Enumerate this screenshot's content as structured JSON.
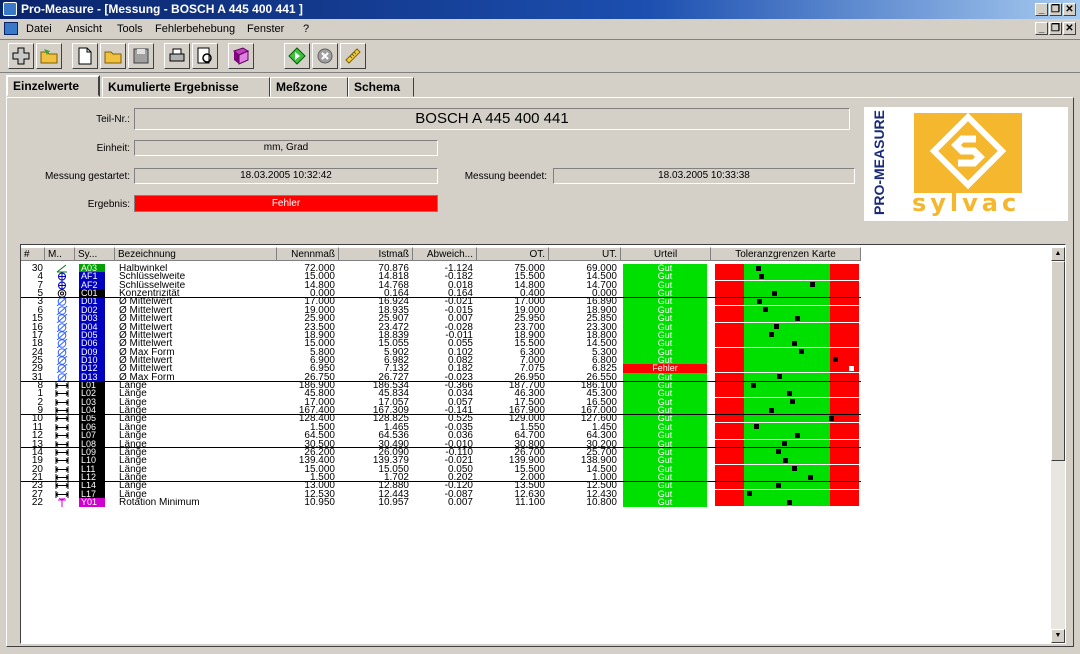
{
  "window": {
    "title": "Pro-Measure - [Messung - BOSCH A 445 400 441 ]",
    "minimize": "_",
    "restore": "❐",
    "close": "✕"
  },
  "menu": [
    "Datei",
    "Ansicht",
    "Tools",
    "Fehlerbehebung",
    "Fenster",
    "?"
  ],
  "toolbar": [
    "add-icon",
    "open-icon",
    "new-document-icon",
    "open-folder-icon",
    "save-icon",
    "print-icon",
    "print-preview-icon",
    "book-icon",
    "start-icon",
    "stop-icon",
    "ruler-icon"
  ],
  "tabs": [
    "Einzelwerte",
    "Kumulierte Ergebnisse",
    "Meßzone",
    "Schema"
  ],
  "header": {
    "teil_label": "Teil-Nr.:",
    "teil_value": "BOSCH A 445 400 441",
    "einheit_label": "Einheit:",
    "einheit_value": "mm, Grad",
    "start_label": "Messung gestartet:",
    "start_value": "18.03.2005  10:32:42",
    "end_label": "Messung beendet:",
    "end_value": "18.03.2005  10:33:38",
    "ergebnis_label": "Ergebnis:",
    "ergebnis_value": "Fehler"
  },
  "logo": {
    "vertical_text": "PRO-MEASURE",
    "brand": "sylvac"
  },
  "columns": [
    "#",
    "M..",
    "Sy...",
    "Bezeichnung",
    "Nennmaß",
    "Istmaß",
    "Abweich...",
    "OT.",
    "UT.",
    "Urteil",
    "Toleranzgrenzen Karte"
  ],
  "colors": {
    "gut": "#00e000",
    "fehler": "#ff0000",
    "grid_red": "#ff0000",
    "grid_green": "#00e000"
  },
  "rows": [
    {
      "n": "30",
      "sym": "angle",
      "code": "A03",
      "cc": "#00a000",
      "name": "Halbwinkel",
      "nenn": "72.000",
      "ist": "70.876",
      "abw": "-1.124",
      "ot": "75.000",
      "ut": "69.000",
      "urteil": "Gut",
      "pos": 0.3
    },
    {
      "n": "4",
      "sym": "wrench",
      "code": "AF1",
      "cc": "#0000c0",
      "name": "Schlüsselweite",
      "nenn": "15.000",
      "ist": "14.818",
      "abw": "-0.182",
      "ot": "15.500",
      "ut": "14.500",
      "urteil": "Gut",
      "pos": 0.32
    },
    {
      "n": "7",
      "sym": "wrench",
      "code": "AF2",
      "cc": "#0000c0",
      "name": "Schlüsselweite",
      "nenn": "14.800",
      "ist": "14.768",
      "abw": "0.018",
      "ot": "14.800",
      "ut": "14.700",
      "urteil": "Gut",
      "pos": 0.68
    },
    {
      "n": "5",
      "sym": "concentric",
      "code": "C01",
      "cc": "#000000",
      "name": "Konzentrizität",
      "nenn": "0.000",
      "ist": "0.164",
      "abw": "0.164",
      "ot": "0.400",
      "ut": "0.000",
      "urteil": "Gut",
      "pos": 0.41
    },
    {
      "n": "3",
      "sym": "diameter",
      "code": "D01",
      "cc": "#0000c0",
      "name": "Ø Mittelwert",
      "nenn": "17.000",
      "ist": "16.924",
      "abw": "-0.021",
      "ot": "17.000",
      "ut": "16.890",
      "urteil": "Gut",
      "pos": 0.31
    },
    {
      "n": "6",
      "sym": "diameter",
      "code": "D02",
      "cc": "#0000c0",
      "name": "Ø Mittelwert",
      "nenn": "19.000",
      "ist": "18.935",
      "abw": "-0.015",
      "ot": "19.000",
      "ut": "18.900",
      "urteil": "Gut",
      "pos": 0.35
    },
    {
      "n": "15",
      "sym": "diameter",
      "code": "D03",
      "cc": "#0000c0",
      "name": "Ø Mittelwert",
      "nenn": "25.900",
      "ist": "25.907",
      "abw": "0.007",
      "ot": "25.950",
      "ut": "25.850",
      "urteil": "Gut",
      "pos": 0.57
    },
    {
      "n": "16",
      "sym": "diameter",
      "code": "D04",
      "cc": "#0000c0",
      "name": "Ø Mittelwert",
      "nenn": "23.500",
      "ist": "23.472",
      "abw": "-0.028",
      "ot": "23.700",
      "ut": "23.300",
      "urteil": "Gut",
      "pos": 0.43
    },
    {
      "n": "17",
      "sym": "diameter",
      "code": "D05",
      "cc": "#0000c0",
      "name": "Ø Mittelwert",
      "nenn": "18.900",
      "ist": "18.839",
      "abw": "-0.011",
      "ot": "18.900",
      "ut": "18.800",
      "urteil": "Gut",
      "pos": 0.39
    },
    {
      "n": "18",
      "sym": "diameter",
      "code": "D06",
      "cc": "#0000c0",
      "name": "Ø Mittelwert",
      "nenn": "15.000",
      "ist": "15.055",
      "abw": "0.055",
      "ot": "15.500",
      "ut": "14.500",
      "urteil": "Gut",
      "pos": 0.55
    },
    {
      "n": "24",
      "sym": "diameter",
      "code": "D09",
      "cc": "#0000c0",
      "name": "Ø Max Form",
      "nenn": "5.800",
      "ist": "5.902",
      "abw": "0.102",
      "ot": "6.300",
      "ut": "5.300",
      "urteil": "Gut",
      "pos": 0.6
    },
    {
      "n": "25",
      "sym": "diameter",
      "code": "D10",
      "cc": "#0000c0",
      "name": "Ø Mittelwert",
      "nenn": "6.900",
      "ist": "6.982",
      "abw": "0.082",
      "ot": "7.000",
      "ut": "6.800",
      "urteil": "Gut",
      "pos": 0.84
    },
    {
      "n": "29",
      "sym": "diameter",
      "code": "D12",
      "cc": "#0000c0",
      "name": "Ø Mittelwert",
      "nenn": "6.950",
      "ist": "7.132",
      "abw": "0.182",
      "ot": "7.075",
      "ut": "6.825",
      "urteil": "Fehler",
      "pos": 0.95
    },
    {
      "n": "31",
      "sym": "diameter",
      "code": "D13",
      "cc": "#0000c0",
      "name": "Ø Max Form",
      "nenn": "26.750",
      "ist": "26.727",
      "abw": "-0.023",
      "ot": "26.950",
      "ut": "26.550",
      "urteil": "Gut",
      "pos": 0.45
    },
    {
      "n": "8",
      "sym": "length",
      "code": "L01",
      "cc": "#000000",
      "name": "Länge",
      "nenn": "186.900",
      "ist": "186.534",
      "abw": "-0.366",
      "ot": "187.700",
      "ut": "186.100",
      "urteil": "Gut",
      "pos": 0.27
    },
    {
      "n": "1",
      "sym": "length",
      "code": "L02",
      "cc": "#000000",
      "name": "Länge",
      "nenn": "45.800",
      "ist": "45.834",
      "abw": "0.034",
      "ot": "46.300",
      "ut": "45.300",
      "urteil": "Gut",
      "pos": 0.52
    },
    {
      "n": "2",
      "sym": "length",
      "code": "L03",
      "cc": "#000000",
      "name": "Länge",
      "nenn": "17.000",
      "ist": "17.057",
      "abw": "0.057",
      "ot": "17.500",
      "ut": "16.500",
      "urteil": "Gut",
      "pos": 0.54
    },
    {
      "n": "9",
      "sym": "length",
      "code": "L04",
      "cc": "#000000",
      "name": "Länge",
      "nenn": "167.400",
      "ist": "167.309",
      "abw": "-0.141",
      "ot": "167.900",
      "ut": "167.000",
      "urteil": "Gut",
      "pos": 0.39
    },
    {
      "n": "10",
      "sym": "length",
      "code": "L05",
      "cc": "#000000",
      "name": "Länge",
      "nenn": "128.400",
      "ist": "128.825",
      "abw": "0.525",
      "ot": "129.000",
      "ut": "127.600",
      "urteil": "Gut",
      "pos": 0.81
    },
    {
      "n": "11",
      "sym": "length",
      "code": "L06",
      "cc": "#000000",
      "name": "Länge",
      "nenn": "1.500",
      "ist": "1.465",
      "abw": "-0.035",
      "ot": "1.550",
      "ut": "1.450",
      "urteil": "Gut",
      "pos": 0.29
    },
    {
      "n": "12",
      "sym": "length",
      "code": "L07",
      "cc": "#000000",
      "name": "Länge",
      "nenn": "64.500",
      "ist": "64.536",
      "abw": "0.036",
      "ot": "64.700",
      "ut": "64.300",
      "urteil": "Gut",
      "pos": 0.57
    },
    {
      "n": "13",
      "sym": "length",
      "code": "L08",
      "cc": "#000000",
      "name": "Länge",
      "nenn": "30.500",
      "ist": "30.490",
      "abw": "-0.010",
      "ot": "30.800",
      "ut": "30.200",
      "urteil": "Gut",
      "pos": 0.48
    },
    {
      "n": "14",
      "sym": "length",
      "code": "L09",
      "cc": "#000000",
      "name": "Länge",
      "nenn": "26.200",
      "ist": "26.090",
      "abw": "-0.110",
      "ot": "26.700",
      "ut": "25.700",
      "urteil": "Gut",
      "pos": 0.44
    },
    {
      "n": "19",
      "sym": "length",
      "code": "L10",
      "cc": "#000000",
      "name": "Länge",
      "nenn": "139.400",
      "ist": "139.379",
      "abw": "-0.021",
      "ot": "139.900",
      "ut": "138.900",
      "urteil": "Gut",
      "pos": 0.49
    },
    {
      "n": "20",
      "sym": "length",
      "code": "L11",
      "cc": "#000000",
      "name": "Länge",
      "nenn": "15.000",
      "ist": "15.050",
      "abw": "0.050",
      "ot": "15.500",
      "ut": "14.500",
      "urteil": "Gut",
      "pos": 0.55
    },
    {
      "n": "21",
      "sym": "length",
      "code": "L12",
      "cc": "#000000",
      "name": "Länge",
      "nenn": "1.500",
      "ist": "1.702",
      "abw": "0.202",
      "ot": "2.000",
      "ut": "1.000",
      "urteil": "Gut",
      "pos": 0.66
    },
    {
      "n": "23",
      "sym": "length",
      "code": "L14",
      "cc": "#000000",
      "name": "Länge",
      "nenn": "13.000",
      "ist": "12.880",
      "abw": "-0.120",
      "ot": "13.500",
      "ut": "12.500",
      "urteil": "Gut",
      "pos": 0.44
    },
    {
      "n": "27",
      "sym": "length",
      "code": "L17",
      "cc": "#000000",
      "name": "Länge",
      "nenn": "12.530",
      "ist": "12.443",
      "abw": "-0.087",
      "ot": "12.630",
      "ut": "12.430",
      "urteil": "Gut",
      "pos": 0.24
    },
    {
      "n": "22",
      "sym": "rotation",
      "code": "Y01",
      "cc": "#d000d0",
      "name": "Rotation Minimum",
      "nenn": "10.950",
      "ist": "10.957",
      "abw": "0.007",
      "ot": "11.100",
      "ut": "10.800",
      "urteil": "Gut",
      "pos": 0.52
    }
  ],
  "separators_after": [
    3,
    13,
    17,
    21,
    25
  ]
}
